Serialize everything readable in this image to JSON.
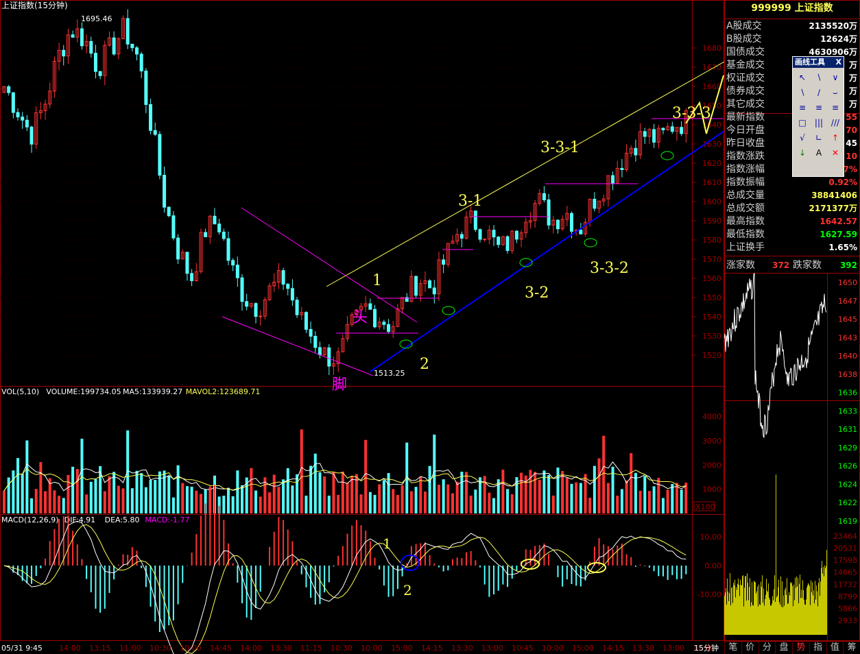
{
  "window": {
    "title": "上证指数(15分钟)"
  },
  "colors": {
    "up": "#ff3232",
    "down": "#54ffff",
    "frame": "#a00000",
    "yellow": "#ffff54",
    "magenta": "#ff00ff",
    "blue": "#0000ff",
    "white": "#ffffff",
    "green": "#00ff00"
  },
  "chart_data": [
    {
      "type": "candlestick",
      "title": "上证指数(15分钟)",
      "ylim": [
        1505,
        1700
      ],
      "y_ticks": [
        1520,
        1530,
        1540,
        1550,
        1560,
        1570,
        1580,
        1590,
        1600,
        1610,
        1620,
        1630,
        1640,
        1650,
        1660,
        1670,
        1680
      ],
      "high_label": "1695.46",
      "low_label": "1513.25",
      "trend_path": [
        1660,
        1648,
        1635,
        1650,
        1675,
        1690,
        1685,
        1670,
        1680,
        1690,
        1675,
        1640,
        1600,
        1575,
        1560,
        1585,
        1590,
        1565,
        1550,
        1545,
        1555,
        1560,
        1540,
        1530,
        1520,
        1518,
        1535,
        1545,
        1540,
        1535,
        1550,
        1560,
        1555,
        1570,
        1585,
        1590,
        1585,
        1575,
        1580,
        1595,
        1600,
        1590,
        1595,
        1585,
        1600,
        1610,
        1620,
        1630,
        1635,
        1632,
        1640,
        1642
      ],
      "annotations": [
        "1",
        "2",
        "头",
        "脚",
        "3-1",
        "3-2",
        "3-3-1",
        "3-3-2",
        "3-3-3"
      ]
    },
    {
      "type": "bar",
      "title": "VOL(5,10)",
      "header_parts": [
        "VOL(5,10)",
        "VOLUME:199734.05",
        "MA5:133939.27",
        "MAVOL2:123689.71"
      ],
      "ylim": [
        0,
        4500
      ],
      "y_ticks": [
        1000,
        2000,
        3000,
        4000
      ],
      "unit_label": "X100"
    },
    {
      "type": "bar",
      "title": "MACD(12,26,9)",
      "header_parts": [
        "MACD(12,26,9)",
        "DIF:4.91",
        "DEA:5.80",
        "MACD:-1.77"
      ],
      "ylim": [
        -25,
        15
      ],
      "y_ticks": [
        "10.00",
        "0.00",
        "-10.00"
      ],
      "annotations": [
        "1",
        "2"
      ]
    },
    {
      "type": "line",
      "title": "tick",
      "y_ticks": [
        "1650",
        "1647",
        "1645",
        "1643",
        "1640",
        "1638",
        "1636",
        "1633",
        "1631",
        "1629",
        "1626",
        "1624",
        "1622",
        "1619"
      ],
      "vol_ticks": [
        "23464",
        "20531",
        "17598",
        "14665",
        "11732",
        "8799",
        "5866",
        "2933"
      ]
    }
  ],
  "axis": {
    "x_labels": [
      "05/31  9:45",
      "14:00",
      "13:15",
      "11:00",
      "10:30",
      "10:00",
      "14:45",
      "14:00",
      "13:30",
      "11:15",
      "10:30",
      "10:00",
      "15:00",
      "14:15",
      "13:30",
      "13:00",
      "10:45",
      "10:00",
      "15:00",
      "14:15",
      "13:30",
      "13:00",
      "11:00"
    ],
    "period": "15分钟"
  },
  "quote": {
    "header": "999999 上证指数",
    "rows": [
      {
        "k": "A股成交",
        "v": "2135520万"
      },
      {
        "k": "B股成交",
        "v": "12624万"
      },
      {
        "k": "国债成交",
        "v": "4630906万"
      },
      {
        "k": "基金成交",
        "v": "万"
      },
      {
        "k": "权证成交",
        "v": "万"
      },
      {
        "k": "债券成交",
        "v": "万"
      },
      {
        "k": "其它成交",
        "v": "万"
      },
      {
        "k": "最新指数",
        "v": "55"
      },
      {
        "k": "今日开盘",
        "v": "70"
      },
      {
        "k": "昨日收盘",
        "v": "45"
      },
      {
        "k": "指数涨跌",
        "v": "10"
      },
      {
        "k": "指数涨幅",
        "v": "7%"
      },
      {
        "k": "指数振幅",
        "v": "0.92%"
      },
      {
        "k": "总成交量",
        "v": "38841406"
      },
      {
        "k": "总成交额",
        "v": "2171377万"
      },
      {
        "k": "最高指数",
        "v": "1642.57"
      },
      {
        "k": "最低指数",
        "v": "1627.59"
      },
      {
        "k": "上证换手",
        "v": "1.65%"
      }
    ],
    "adv_label": "涨家数",
    "adv": "372",
    "dec_label": "跌家数",
    "dec": "392"
  },
  "tools": {
    "title": "画线工具",
    "close": "X"
  },
  "tabs": [
    "笔",
    "价",
    "分",
    "盘",
    "势",
    "指",
    "值",
    "筹"
  ]
}
